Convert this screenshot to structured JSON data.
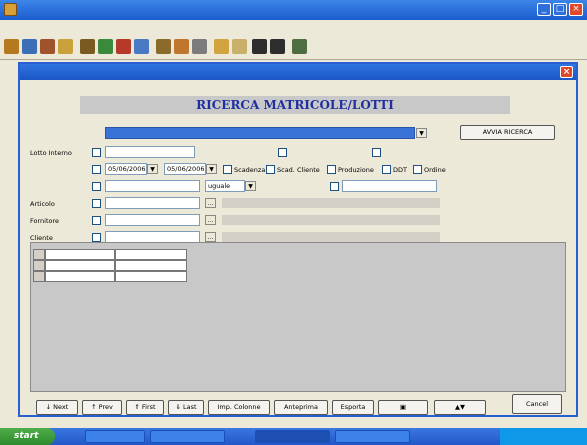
{
  "dialog": {
    "page_title": "RICERCA MATRICOLE/LOTTI"
  },
  "form": {
    "action_button": "AVVIA RICERCA",
    "lotto_interno_label": "Lotto Interno",
    "date_from": "05/06/2006",
    "date_to": "05/06/2006",
    "scadenza_label": "Scadenza",
    "scad_cliente_label": "Scad. Cliente",
    "produzione_label": "Produzione",
    "ddt_label": "DDT",
    "ordine_label": "Ordine",
    "operator_value": "uguale",
    "articolo_label": "Articolo",
    "fornitore_label": "Fornitore",
    "cliente_label": "Cliente"
  },
  "bottom_bar": {
    "next_label": "Next",
    "prev_label": "Prev",
    "first_label": "First",
    "last_label": "Last",
    "colonne_label": "Imp. Colonne",
    "anteprima_label": "Anteprima",
    "esporta_label": "Esporta",
    "cancel_label": "Cancel"
  },
  "taskbar": {
    "start_label": "start"
  },
  "colors": {
    "title_blue": "#1e2fa0",
    "titlebar_blue": "#1c5ccf",
    "close_red": "#e0482a",
    "start_green": "#2e8a2c"
  }
}
